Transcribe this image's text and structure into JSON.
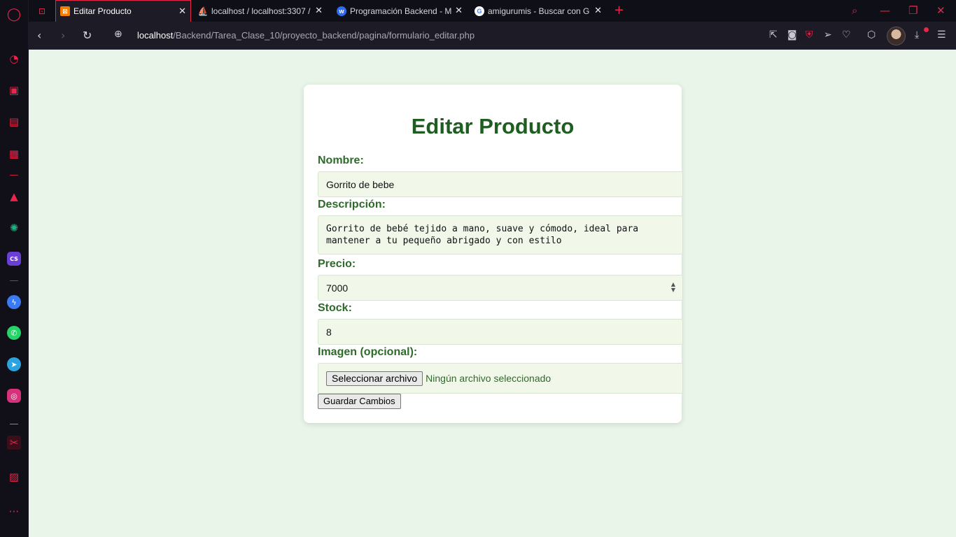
{
  "sidebar": {
    "icons": [
      "opera-logo-icon",
      "speed-dial-icon",
      "bag-icon",
      "twitch-icon",
      "extensions-icon",
      "aria-icon",
      "chatgpt-icon",
      "cs-icon",
      "messenger-icon",
      "whatsapp-icon",
      "telegram-icon",
      "instagram-icon",
      "player-icon",
      "gallery-icon",
      "more-icon"
    ],
    "cs_label": "CS"
  },
  "tabs": [
    {
      "title": "Editar Producto",
      "icon": "xampp-icon",
      "color": "#f57c00"
    },
    {
      "title": "localhost / localhost:3307 /",
      "icon": "phpmyadmin-icon",
      "color": "#f5a623"
    },
    {
      "title": "Programación Backend - M",
      "icon": "webex-icon",
      "color": "#2f6cf6"
    },
    {
      "title": "amigurumis - Buscar con G",
      "icon": "google-icon",
      "color": "#ffffff"
    }
  ],
  "new_tab": "+",
  "address": {
    "host": "localhost",
    "path": "/Backend/Tarea_Clase_10/proyecto_backend/pagina/formulario_editar.php"
  },
  "form": {
    "title": "Editar Producto",
    "nombre_label": "Nombre:",
    "nombre_value": "Gorrito de bebe",
    "descripcion_label": "Descripción:",
    "descripcion_value": "Gorrito de bebé tejido a mano, suave y cómodo, ideal para\nmantener a tu pequeño abrigado y con estilo",
    "precio_label": "Precio:",
    "precio_value": "7000",
    "stock_label": "Stock:",
    "stock_value": "8",
    "imagen_label": "Imagen (opcional):",
    "file_button": "Seleccionar archivo",
    "file_status": "Ningún archivo seleccionado",
    "submit_label": "Guardar Cambios"
  },
  "colors": {
    "accent": "#e8254a",
    "page_bg": "#e8f5e8",
    "heading": "#1e5e20",
    "label": "#2e6b2a"
  }
}
